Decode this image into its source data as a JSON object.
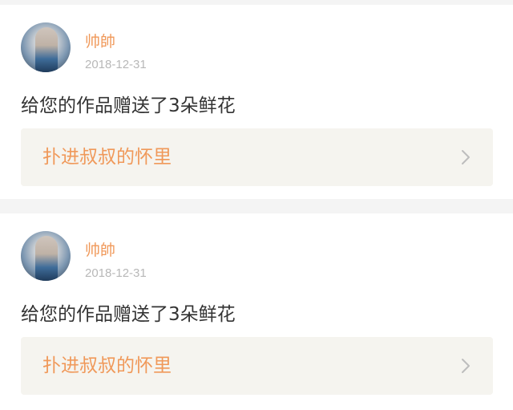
{
  "notifications": [
    {
      "user": "帅帥",
      "date": "2018-12-31",
      "message": "给您的作品赠送了3朵鲜花",
      "link_label": "扑进叔叔的怀里",
      "avatar_icon": "user-avatar-photo",
      "link_icon": "chevron-right-icon"
    },
    {
      "user": "帅帥",
      "date": "2018-12-31",
      "message": "给您的作品赠送了3朵鲜花",
      "link_label": "扑进叔叔的怀里",
      "avatar_icon": "user-avatar-photo",
      "link_icon": "chevron-right-icon"
    }
  ],
  "colors": {
    "accent": "#f0995a",
    "text": "#333333",
    "muted": "#b8b8b8",
    "link_bg": "#f5f4ef",
    "divider": "#f4f4f4"
  }
}
